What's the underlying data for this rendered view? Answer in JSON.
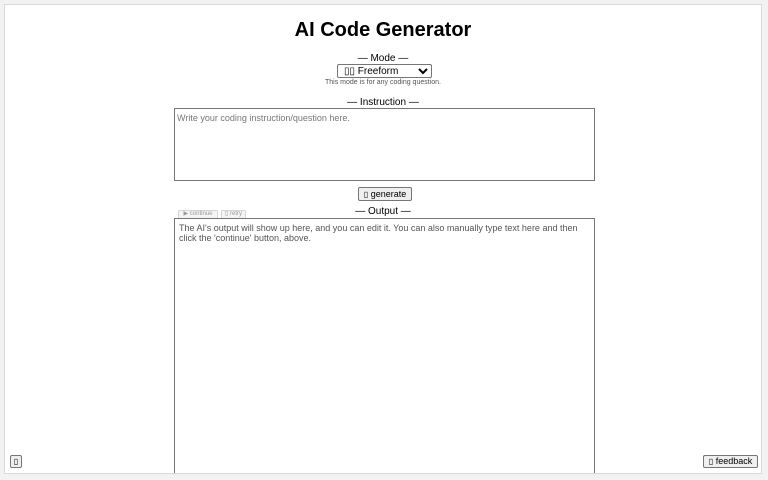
{
  "header": {
    "title": "AI Code Generator"
  },
  "mode": {
    "label": "— Mode —",
    "selected_icon": "▯▯",
    "selected": "Freeform",
    "description": "This mode is for any coding question."
  },
  "instruction": {
    "label": "— Instruction —",
    "placeholder": "Write your coding instruction/question here."
  },
  "generate": {
    "icon": "▯",
    "label": "generate"
  },
  "output": {
    "label": "— Output —",
    "continue_label": "▶ continue",
    "retry_label": "▯ retry",
    "placeholder": "The AI's output will show up here, and you can edit it. You can also manually type text here and then click the 'continue' button, above."
  },
  "footer": {
    "corner_icon": "▯",
    "feedback_icon": "▯",
    "feedback_label": "feedback"
  },
  "colors": {
    "background": "#f2f2f2",
    "panel": "#ffffff",
    "border": "#767676"
  }
}
